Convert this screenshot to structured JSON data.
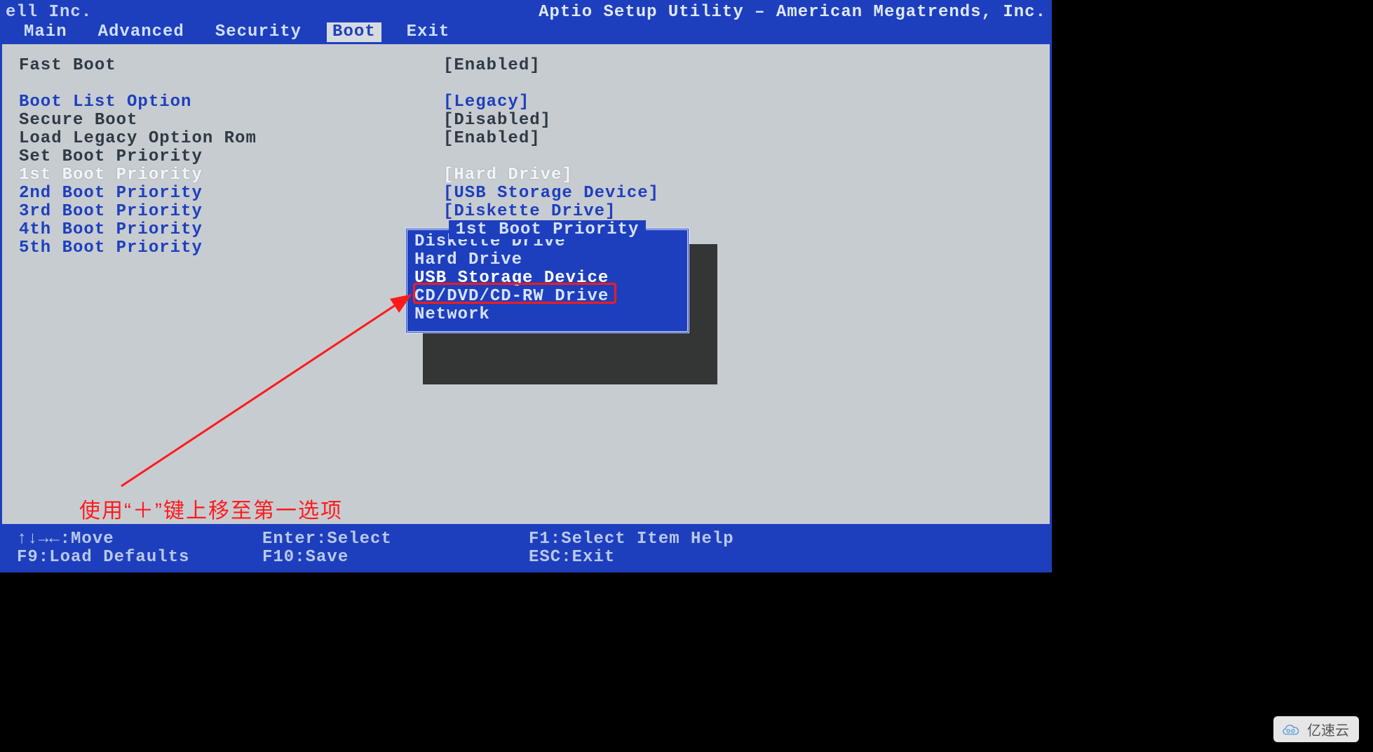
{
  "vendor": "ell Inc.",
  "utility_title": "Aptio Setup Utility – American Megatrends, Inc.",
  "menus": {
    "items": [
      "Main",
      "Advanced",
      "Security",
      "Boot",
      "Exit"
    ],
    "active_index": 3
  },
  "settings": [
    {
      "label": "Fast Boot",
      "value": "[Enabled]",
      "style": "dark"
    },
    {
      "label": "",
      "value": "",
      "style": "dark"
    },
    {
      "label": "Boot List Option",
      "value": "[Legacy]",
      "style": "blue"
    },
    {
      "label": "Secure Boot",
      "value": "[Disabled]",
      "style": "dark"
    },
    {
      "label": "Load Legacy Option Rom",
      "value": "[Enabled]",
      "style": "dark"
    },
    {
      "label": "Set Boot Priority",
      "value": "",
      "style": "dark"
    },
    {
      "label": "1st Boot Priority",
      "value": "[Hard Drive]",
      "style": "white"
    },
    {
      "label": "2nd Boot Priority",
      "value": "[USB Storage Device]",
      "style": "blue"
    },
    {
      "label": "3rd Boot Priority",
      "value": "[Diskette Drive]",
      "style": "blue"
    },
    {
      "label": "4th Boot Priority",
      "value": "",
      "style": "blue"
    },
    {
      "label": "5th Boot Priority",
      "value": "",
      "style": "blue"
    }
  ],
  "popup": {
    "title": "1st Boot Priority",
    "items": [
      "Diskette Drive",
      "Hard Drive",
      "USB Storage Device",
      "CD/DVD/CD-RW Drive",
      "Network"
    ],
    "selected_index": 2
  },
  "footer": {
    "rows": [
      {
        "c1": "↑↓→←:Move",
        "c2": "Enter:Select",
        "c3": "F1:Select Item Help"
      },
      {
        "c1": "F9:Load Defaults",
        "c2": "F10:Save",
        "c3": "ESC:Exit"
      }
    ]
  },
  "annotation": {
    "text": "使用“＋”键上移至第一选项"
  },
  "watermark": {
    "text": "亿速云"
  }
}
